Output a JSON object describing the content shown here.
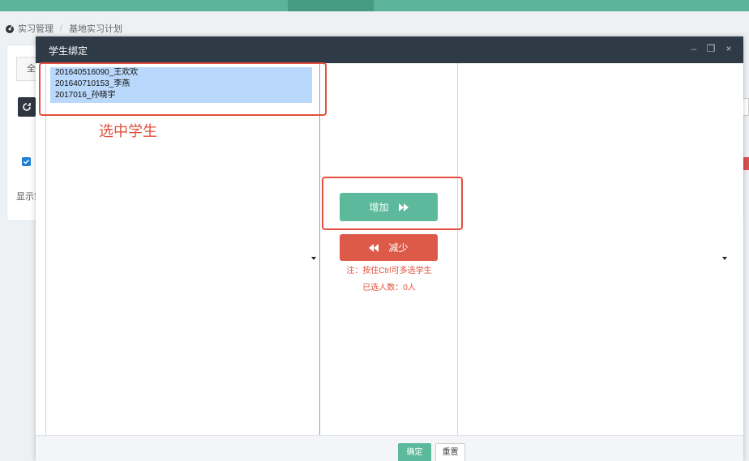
{
  "breadcrumb": {
    "home": "实习管理",
    "current": "基地实习计划"
  },
  "background": {
    "tab_partial": "全",
    "show_text_partial": "显示第"
  },
  "modal": {
    "title": "学生绑定",
    "controls": {
      "minimize": "–",
      "maximize": "❐",
      "close": "×"
    },
    "left_list": {
      "items": [
        "201640516090_王欢欢",
        "201640710153_李燕",
        "2017016_孙晓宇"
      ]
    },
    "annotation_selected": "选中学生",
    "add_button": "增加",
    "remove_button": "减少",
    "note": "注：按住Ctrl可多选学生",
    "selected_count": "已选人数：0人",
    "footer": {
      "confirm": "确定",
      "reset": "重置"
    }
  },
  "colors": {
    "teal": "#5cb99b",
    "red": "#dc5a47",
    "annotation": "#e24f3c",
    "header": "#2f3a47",
    "selection": "#b9d8fb"
  }
}
